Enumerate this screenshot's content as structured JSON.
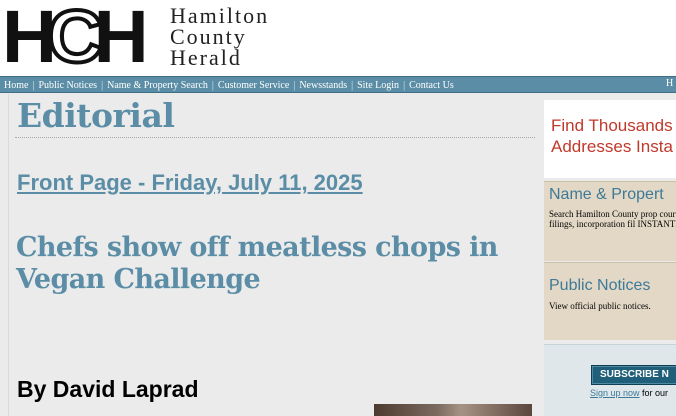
{
  "logo": {
    "mark_letters": [
      "H",
      "C",
      "H"
    ],
    "name_lines": [
      "Hamilton",
      "County",
      "Herald"
    ]
  },
  "nav": {
    "items": [
      "Home",
      "Public Notices",
      "Name & Property Search",
      "Customer Service",
      "Newsstands",
      "Site Login",
      "Contact Us"
    ],
    "right_fragment": "H"
  },
  "main": {
    "section_title": "Editorial",
    "front_page_link": "Front Page - Friday, July 11, 2025",
    "headline": "Chefs show off meatless chops in Vegan Challenge",
    "byline": "By David Laprad"
  },
  "sidebar": {
    "ad_find": {
      "line1": "Find Thousands",
      "line2": "Addresses Insta"
    },
    "name_property": {
      "title": "Name & Propert",
      "description": "Search Hamilton County prop court filings, incorporation fil INSTANTLY."
    },
    "public_notices": {
      "title": "Public Notices",
      "description": "View official public notices."
    },
    "subscribe": {
      "button_label": "SUBSCRIBE N",
      "signup_link": "Sign up now",
      "signup_rest": " for our"
    }
  },
  "colors": {
    "accent": "#5b8ea6",
    "nav_bg": "#5b8ea6",
    "ad_red": "#c0392b",
    "sidebar_box": "#e3d8c5",
    "subscribe_button": "#1f5f7a"
  }
}
